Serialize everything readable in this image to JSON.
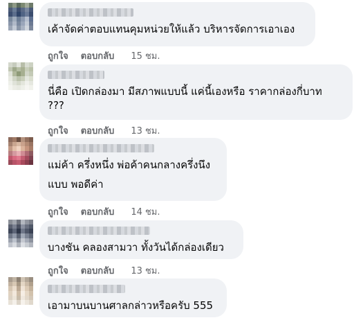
{
  "actions": {
    "like": "ถูกใจ",
    "reply": "ตอบกลับ"
  },
  "comments": [
    {
      "text": [
        "เค้าจัดค่าตอบแทนคุมหน่วยให้แล้ว บริหารจัดการเอาเอง"
      ],
      "time": "15 ชม."
    },
    {
      "text": [
        "นี่คือ เปิดกล่องมา มีสภาพแบบนี้ แค่นี้เองหรือ ราคากล่องกี่บาท\n???"
      ],
      "time": "13 ชม."
    },
    {
      "text": [
        "แม่ค้า ครึ่งหนึ่ง พ่อค้าคนกลางครึ่งนึง",
        "แบบ พอดีค่า"
      ],
      "time": "14 ชม."
    },
    {
      "text": [
        "บางชัน คลองสามวา ทั้งวันได้กล่องเดียว"
      ],
      "time": "13 ชม."
    },
    {
      "text": [
        "เอามาบนบานศาลกล่าวหรือครับ 555"
      ],
      "time": ""
    }
  ]
}
